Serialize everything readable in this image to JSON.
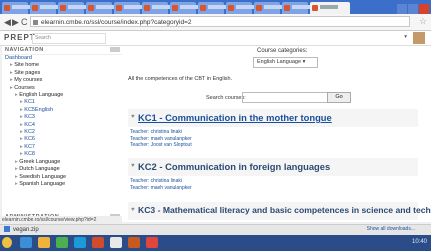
{
  "browser": {
    "url": "elearnin.cmbe.ro/ssl/course/index.php?categoryid=2",
    "nav_back": "◀",
    "nav_forward": "▶",
    "nav_reload": "C",
    "bookmark_icon": "star-icon"
  },
  "site": {
    "brand": "PREPT",
    "search_placeholder": "Search"
  },
  "sidebar": {
    "navigation_title": "NAVIGATION",
    "admin_title": "ADMINISTRATION",
    "items": [
      {
        "label": "Dashboard",
        "link": true,
        "indent": 0
      },
      {
        "label": "Site home",
        "link": false,
        "indent": 1
      },
      {
        "label": "Site pages",
        "link": false,
        "indent": 1
      },
      {
        "label": "My courses",
        "link": false,
        "indent": 1
      },
      {
        "label": "Courses",
        "link": false,
        "indent": 1
      },
      {
        "label": "English Language",
        "link": false,
        "indent": 2
      },
      {
        "label": "KC1",
        "link": true,
        "indent": 3
      },
      {
        "label": "KC5English",
        "link": true,
        "indent": 3
      },
      {
        "label": "KC3",
        "link": true,
        "indent": 3
      },
      {
        "label": "KC4",
        "link": true,
        "indent": 3
      },
      {
        "label": "KC2",
        "link": true,
        "indent": 3
      },
      {
        "label": "KC6",
        "link": true,
        "indent": 3
      },
      {
        "label": "KC7",
        "link": true,
        "indent": 3
      },
      {
        "label": "KC8",
        "link": true,
        "indent": 3
      },
      {
        "label": "Greek Language",
        "link": false,
        "indent": 2
      },
      {
        "label": "Dutch Language",
        "link": false,
        "indent": 2
      },
      {
        "label": "Swedish Language",
        "link": false,
        "indent": 2
      },
      {
        "label": "Spanish Language",
        "link": false,
        "indent": 2
      }
    ]
  },
  "main": {
    "select_label": "Course categories:",
    "select_value": "English Language",
    "intro": "All the competences of the CBT in English.",
    "search_label": "Search courses:",
    "go_label": "Go",
    "courses": [
      {
        "title": "KC1 - Communication in the mother tongue",
        "link": true,
        "teachers": [
          "Teacher: christina linaki",
          "Teacher: maeh vanulanpker",
          "Teacher: Joost van Sloptout"
        ]
      },
      {
        "title": "KC2 - Communication in foreign languages",
        "link": false,
        "teachers": [
          "Teacher: christina linaki",
          "Teacher: maeh vanulanpker"
        ]
      },
      {
        "title": "KC3 - Mathematical literacy and basic competences in science and technology",
        "link": false,
        "teachers": []
      }
    ],
    "status_url": "elearnin.cmbe.ro/ssl/course/view.php?id=2"
  },
  "downloads": {
    "item": "vegan.zip",
    "show_all": "Show all downloads..."
  },
  "taskbar": {
    "clock": "10:40"
  },
  "colors": {
    "chrome_blue": "#3b6fc9",
    "link": "#1a4f9c",
    "course_title": "#2b4a73",
    "taskbar": "#2a4d89"
  }
}
